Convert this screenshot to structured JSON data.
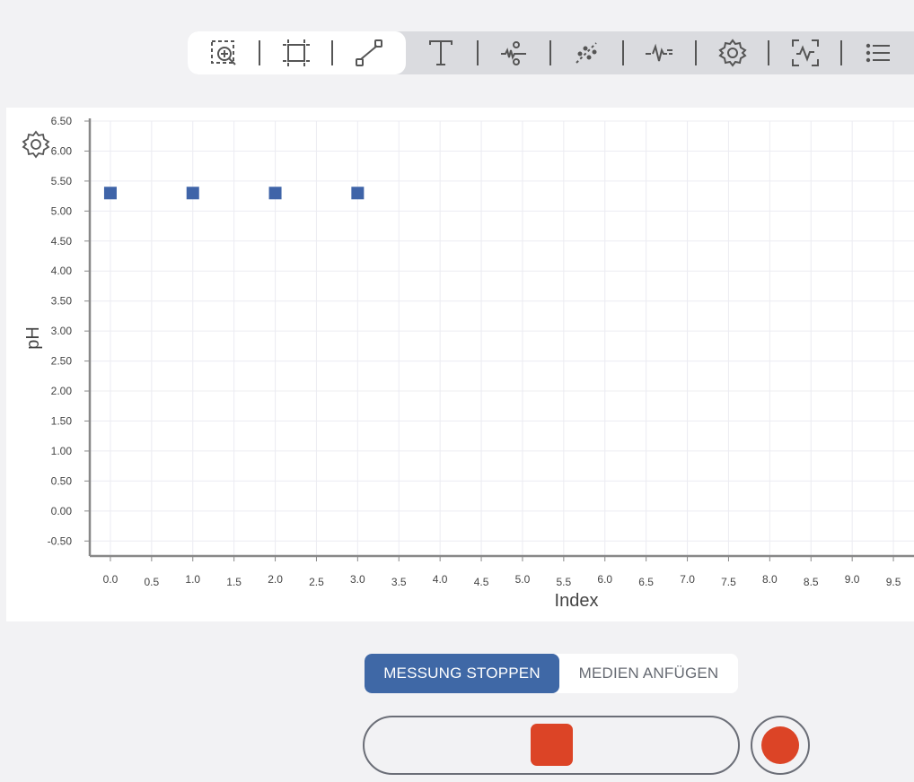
{
  "toolbar": {
    "tools": [
      {
        "icon": "zoom-region-icon",
        "active": true
      },
      {
        "icon": "fit-frame-icon",
        "active": true
      },
      {
        "icon": "connect-points-icon",
        "active": true
      },
      {
        "icon": "text-icon",
        "active": false
      },
      {
        "icon": "stem-plot-icon",
        "active": false
      },
      {
        "icon": "trendline-icon",
        "active": false
      },
      {
        "icon": "signal-icon",
        "active": false
      },
      {
        "icon": "gear-icon",
        "active": false
      },
      {
        "icon": "waveform-frame-icon",
        "active": false
      },
      {
        "icon": "list-icon",
        "active": false
      }
    ]
  },
  "chart_data": {
    "type": "scatter",
    "xlabel": "Index",
    "ylabel": "pH",
    "xlim": [
      -0.25,
      9.75
    ],
    "ylim": [
      -0.75,
      6.5
    ],
    "x_ticks": [
      "0.0",
      "0.5",
      "1.0",
      "1.5",
      "2.0",
      "2.5",
      "3.0",
      "3.5",
      "4.0",
      "4.5",
      "5.0",
      "5.5",
      "6.0",
      "6.5",
      "7.0",
      "7.5",
      "8.0",
      "8.5",
      "9.0",
      "9.5"
    ],
    "y_ticks": [
      "-0.50",
      "0.00",
      "0.50",
      "1.00",
      "1.50",
      "2.00",
      "2.50",
      "3.00",
      "3.50",
      "4.00",
      "4.50",
      "5.00",
      "5.50",
      "6.00",
      "6.50"
    ],
    "y_tick_values": [
      -0.5,
      0,
      0.5,
      1,
      1.5,
      2,
      2.5,
      3,
      3.5,
      4,
      4.5,
      5,
      5.5,
      6,
      6.5
    ],
    "grid": true,
    "marker_color": "#3f64a8",
    "series": [
      {
        "x": [
          0,
          1,
          2,
          3
        ],
        "y": [
          5.3,
          5.3,
          5.3,
          5.3
        ]
      }
    ]
  },
  "controls": {
    "stop_measurement": "MESSUNG STOPPEN",
    "attach_media": "MEDIEN ANFÜGEN",
    "accent_color": "#3f68a6",
    "record_color": "#dc4426"
  }
}
